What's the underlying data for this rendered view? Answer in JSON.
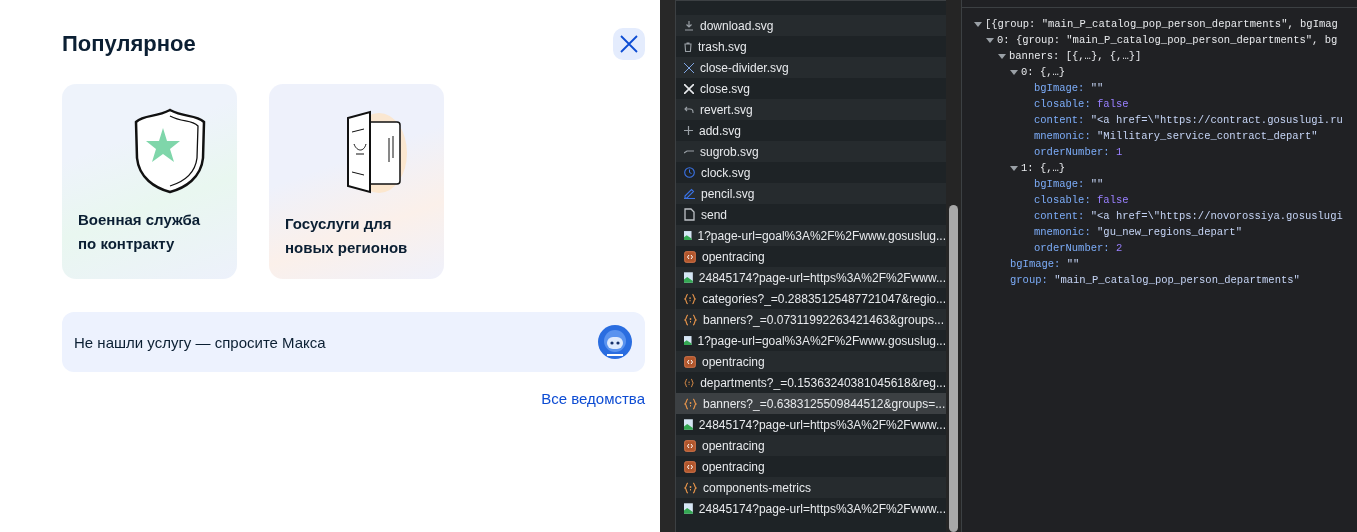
{
  "popular": {
    "title": "Популярное",
    "cards": [
      {
        "kind": "shield",
        "title": "Военная служба по контракту"
      },
      {
        "kind": "passport",
        "title": "Госуслуги для новых регионов"
      }
    ],
    "chat": {
      "text": "Не нашли услугу — спросите Макса"
    },
    "all_link": "Все ведомства"
  },
  "network": {
    "requests": [
      {
        "kind": "download",
        "name": "download.svg",
        "selected": false
      },
      {
        "kind": "trash",
        "name": "trash.svg",
        "selected": false
      },
      {
        "kind": "thin-x",
        "name": "close-divider.svg",
        "selected": false
      },
      {
        "kind": "x",
        "name": "close.svg",
        "selected": false
      },
      {
        "kind": "revert",
        "name": "revert.svg",
        "selected": false
      },
      {
        "kind": "plus",
        "name": "add.svg",
        "selected": false
      },
      {
        "kind": "dash",
        "name": "sugrob.svg",
        "selected": false
      },
      {
        "kind": "clock",
        "name": "clock.svg",
        "selected": false
      },
      {
        "kind": "pencil",
        "name": "pencil.svg",
        "selected": false
      },
      {
        "kind": "doc",
        "name": "send",
        "selected": false
      },
      {
        "kind": "image",
        "name": "1?page-url=goal%3A%2F%2Fwww.gosuslug...",
        "selected": false
      },
      {
        "kind": "script",
        "name": "opentracing",
        "selected": false
      },
      {
        "kind": "image",
        "name": "24845174?page-url=https%3A%2F%2Fwww...",
        "selected": false
      },
      {
        "kind": "fetch",
        "name": "categories?_=0.28835125487721047&regio...",
        "selected": false
      },
      {
        "kind": "fetch",
        "name": "banners?_=0.07311992263421463&groups...",
        "selected": false
      },
      {
        "kind": "image",
        "name": "1?page-url=goal%3A%2F%2Fwww.gosuslug...",
        "selected": false
      },
      {
        "kind": "script",
        "name": "opentracing",
        "selected": false
      },
      {
        "kind": "fetch",
        "name": "departments?_=0.15363240381045618&reg...",
        "selected": false
      },
      {
        "kind": "fetch",
        "name": "banners?_=0.6383125509844512&groups=...",
        "selected": true
      },
      {
        "kind": "image",
        "name": "24845174?page-url=https%3A%2F%2Fwww...",
        "selected": false
      },
      {
        "kind": "script",
        "name": "opentracing",
        "selected": false
      },
      {
        "kind": "script",
        "name": "opentracing",
        "selected": false
      },
      {
        "kind": "fetch",
        "name": "components-metrics",
        "selected": false
      },
      {
        "kind": "image",
        "name": "24845174?page-url=https%3A%2F%2Fwww...",
        "selected": false
      }
    ]
  },
  "preview": {
    "tree": [
      {
        "label": "[{group: \"main_P_catalog_pop_person_departments\", bgImag",
        "expanded": true,
        "children": [
          {
            "label": "0: {group: \"main_P_catalog_pop_person_departments\", bg",
            "expanded": true,
            "children": [
              {
                "label": "banners: [{,…}, {,…}]",
                "expanded": true,
                "children": [
                  {
                    "label": "0: {,…}",
                    "expanded": true,
                    "children": [
                      {
                        "key": "bgImage:",
                        "value": "\"\"",
                        "kind": "string"
                      },
                      {
                        "key": "closable:",
                        "value": "false",
                        "kind": "literal"
                      },
                      {
                        "key": "content:",
                        "value": "\"<a href=\\\"https://contract.gosuslugi.ru",
                        "kind": "string"
                      },
                      {
                        "key": "mnemonic:",
                        "value": "\"Millitary_service_contract_depart\"",
                        "kind": "string"
                      },
                      {
                        "key": "orderNumber:",
                        "value": "1",
                        "kind": "literal"
                      }
                    ]
                  },
                  {
                    "label": "1: {,…}",
                    "expanded": true,
                    "children": [
                      {
                        "key": "bgImage:",
                        "value": "\"\"",
                        "kind": "string"
                      },
                      {
                        "key": "closable:",
                        "value": "false",
                        "kind": "literal"
                      },
                      {
                        "key": "content:",
                        "value": "\"<a href=\\\"https://novorossiya.gosuslugi",
                        "kind": "string"
                      },
                      {
                        "key": "mnemonic:",
                        "value": "\"gu_new_regions_depart\"",
                        "kind": "string"
                      },
                      {
                        "key": "orderNumber:",
                        "value": "2",
                        "kind": "literal"
                      }
                    ]
                  }
                ]
              },
              {
                "key": "bgImage:",
                "value": "\"\"",
                "kind": "string"
              },
              {
                "key": "group:",
                "value": "\"main_P_catalog_pop_person_departments\"",
                "kind": "string"
              }
            ]
          }
        ]
      }
    ]
  }
}
